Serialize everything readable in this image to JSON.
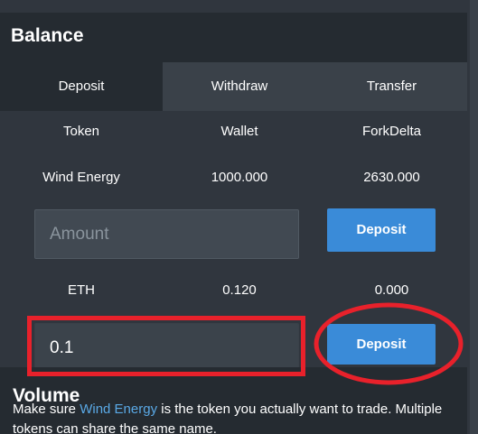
{
  "panel": {
    "title": "Balance"
  },
  "tabs": [
    {
      "label": "Deposit",
      "active": true
    },
    {
      "label": "Withdraw",
      "active": false
    },
    {
      "label": "Transfer",
      "active": false
    }
  ],
  "table": {
    "headers": [
      "Token",
      "Wallet",
      "ForkDelta"
    ],
    "rows": [
      {
        "token": "Wind Energy",
        "wallet": "1000.000",
        "forkdelta": "2630.000"
      },
      {
        "token": "ETH",
        "wallet": "0.120",
        "forkdelta": "0.000"
      }
    ]
  },
  "token_deposit": {
    "amount_placeholder": "Amount",
    "amount_value": "",
    "button_label": "Deposit"
  },
  "eth_deposit": {
    "amount_value": "0.1",
    "button_label": "Deposit"
  },
  "volume": {
    "title": "Volume"
  },
  "tip": {
    "prefix": "Make sure ",
    "token_name": "Wind Energy",
    "suffix": " is the token you actually want to trade. Multiple tokens can share the same name."
  },
  "colors": {
    "accent": "#3a8bd8",
    "annotation": "#e8212b",
    "header_bg": "#252b31",
    "panel_bg": "#30363e"
  }
}
